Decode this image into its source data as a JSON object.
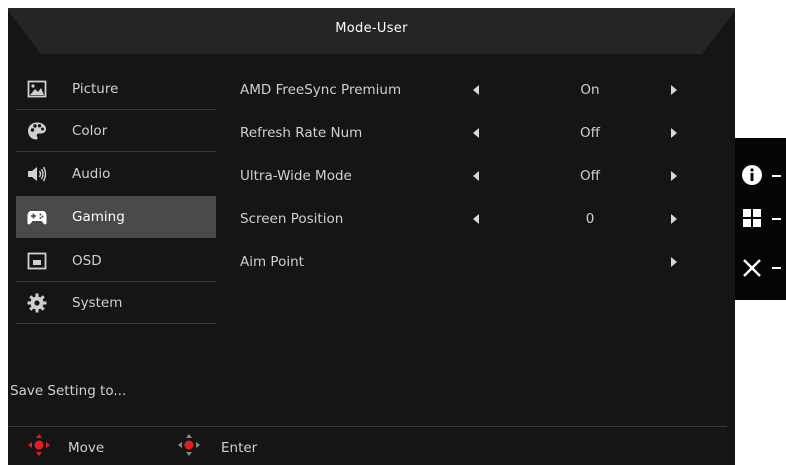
{
  "header": {
    "title": "Mode-User"
  },
  "sidebar": {
    "items": [
      {
        "label": "Picture",
        "icon": "picture-icon",
        "active": false
      },
      {
        "label": "Color",
        "icon": "palette-icon",
        "active": false
      },
      {
        "label": "Audio",
        "icon": "speaker-icon",
        "active": false
      },
      {
        "label": "Gaming",
        "icon": "gamepad-icon",
        "active": true
      },
      {
        "label": "OSD",
        "icon": "osd-icon",
        "active": false
      },
      {
        "label": "System",
        "icon": "gear-icon",
        "active": false
      }
    ],
    "save_label": "Save Setting to..."
  },
  "settings": [
    {
      "label": "AMD FreeSync Premium",
      "value": "On",
      "has_left": true,
      "has_right": true
    },
    {
      "label": "Refresh Rate Num",
      "value": "Off",
      "has_left": true,
      "has_right": true
    },
    {
      "label": "Ultra-Wide Mode",
      "value": "Off",
      "has_left": true,
      "has_right": true
    },
    {
      "label": "Screen Position",
      "value": "0",
      "has_left": true,
      "has_right": true
    },
    {
      "label": "Aim Point",
      "value": "",
      "has_left": false,
      "has_right": true
    }
  ],
  "footer": {
    "move_label": "Move",
    "enter_label": "Enter"
  },
  "side_panel": {
    "icons": [
      "info-icon",
      "menu-grid-icon",
      "close-icon"
    ]
  },
  "colors": {
    "background": "#151515",
    "active": "#4a4a4a",
    "accent_red": "#e02020",
    "panel": "#050505"
  }
}
